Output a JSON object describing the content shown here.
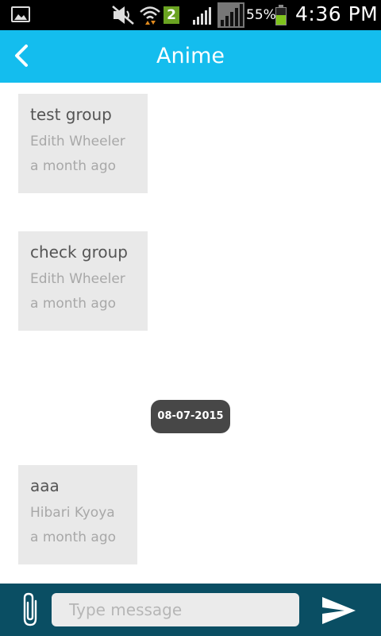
{
  "status_bar": {
    "signal_badge": "2",
    "battery_percent": "55%",
    "time": "4:36 PM",
    "icons": [
      "gallery-icon",
      "mute-icon",
      "wifi-icon",
      "signal-icon",
      "signal-icon",
      "battery-icon"
    ]
  },
  "app_bar": {
    "title": "Anime",
    "background": "#14bdee"
  },
  "messages": [
    {
      "text": "test group",
      "sender": "Edith Wheeler",
      "time": "a month ago"
    },
    {
      "text": "check group",
      "sender": "Edith Wheeler",
      "time": "a month ago"
    },
    {
      "text": "aaa",
      "sender": "Hibari Kyoya",
      "time": "a month ago"
    }
  ],
  "date_separator": "08-07-2015",
  "composer": {
    "placeholder": "Type message",
    "value": "",
    "background": "#0a4e63"
  }
}
